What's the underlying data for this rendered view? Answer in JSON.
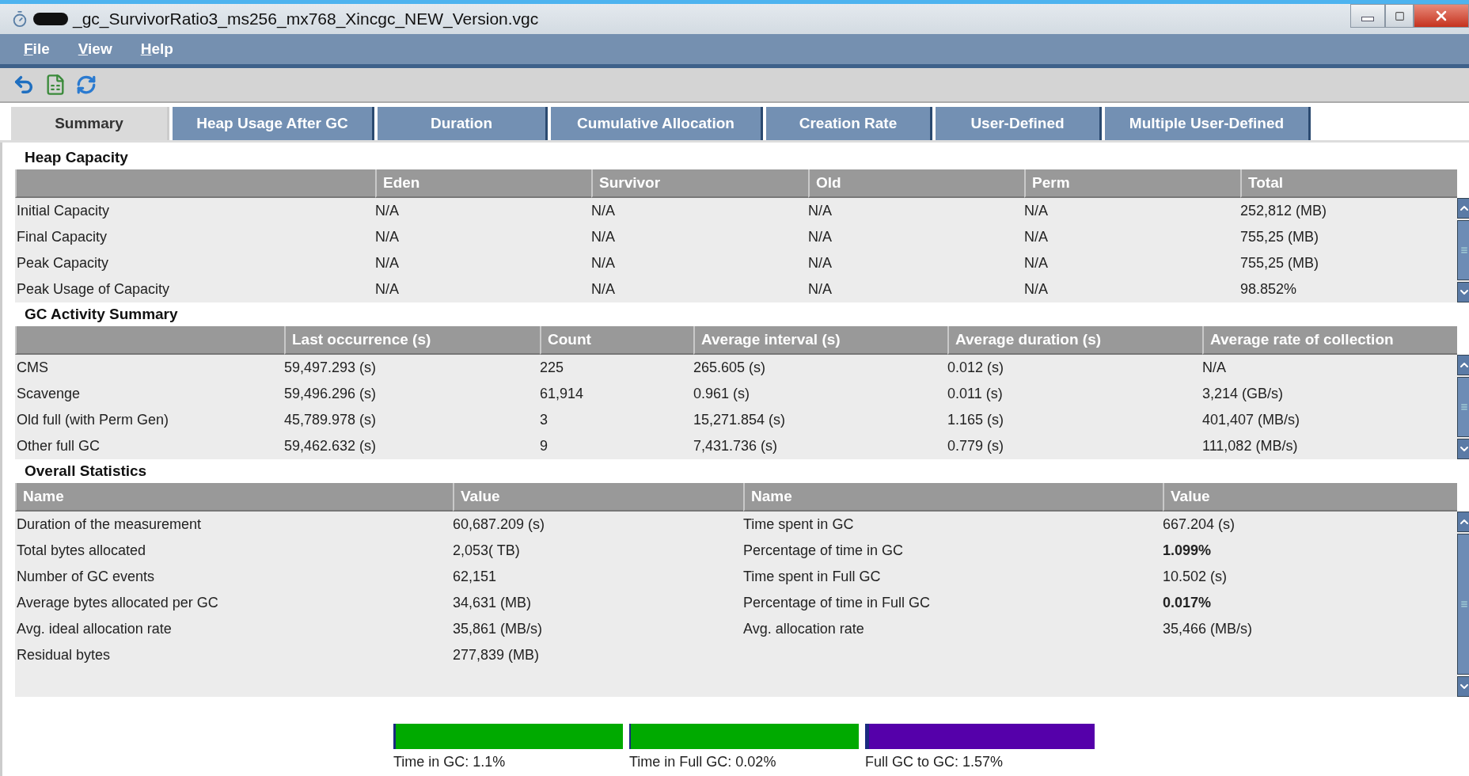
{
  "window": {
    "title": "_gc_SurvivorRatio3_ms256_mx768_Xincgc_NEW_Version.vgc"
  },
  "menu": [
    {
      "label": "File"
    },
    {
      "label": "View"
    },
    {
      "label": "Help"
    }
  ],
  "tabs": [
    {
      "label": "Summary",
      "selected": true
    },
    {
      "label": "Heap Usage After GC",
      "selected": false
    },
    {
      "label": "Duration",
      "selected": false
    },
    {
      "label": "Cumulative Allocation",
      "selected": false
    },
    {
      "label": "Creation Rate",
      "selected": false
    },
    {
      "label": "User-Defined",
      "selected": false
    },
    {
      "label": "Multiple User-Defined",
      "selected": false
    }
  ],
  "tables": [
    {
      "title": "Heap Capacity",
      "columns": [
        "",
        "Eden",
        "Survivor",
        "Old",
        "Perm",
        "Total"
      ],
      "rows": [
        [
          "Initial Capacity",
          "N/A",
          "N/A",
          "N/A",
          "N/A",
          "252,812 (MB)"
        ],
        [
          "Final Capacity",
          "N/A",
          "N/A",
          "N/A",
          "N/A",
          "755,25 (MB)"
        ],
        [
          "Peak Capacity",
          "N/A",
          "N/A",
          "N/A",
          "N/A",
          "755,25 (MB)"
        ],
        [
          "Peak Usage of Capacity",
          "N/A",
          "N/A",
          "N/A",
          "N/A",
          "98.852%"
        ]
      ]
    },
    {
      "title": "GC Activity Summary",
      "columns": [
        "",
        "Last occurrence (s)",
        "Count",
        "Average interval (s)",
        "Average duration (s)",
        "Average rate of collection"
      ],
      "rows": [
        [
          "CMS",
          "59,497.293 (s)",
          "225",
          "265.605 (s)",
          "0.012 (s)",
          "N/A"
        ],
        [
          "Scavenge",
          "59,496.296 (s)",
          "61,914",
          "0.961 (s)",
          "0.011 (s)",
          "3,214 (GB/s)"
        ],
        [
          "Old full (with Perm Gen)",
          "45,789.978 (s)",
          "3",
          "15,271.854 (s)",
          "1.165 (s)",
          "401,407 (MB/s)"
        ],
        [
          "Other full GC",
          "59,462.632 (s)",
          "9",
          "7,431.736 (s)",
          "0.779 (s)",
          "111,082 (MB/s)"
        ]
      ]
    },
    {
      "title": "Overall Statistics",
      "columns": [
        "Name",
        "Value",
        "Name",
        "Value"
      ],
      "rows": [
        [
          "Duration of the measurement",
          "60,687.209 (s)",
          "Time spent in GC",
          "667.204 (s)"
        ],
        [
          "Total bytes allocated",
          "2,053( TB)",
          "Percentage of time in GC",
          {
            "text": "1.099%",
            "bold": true
          }
        ],
        [
          "Number of GC events",
          "62,151",
          "Time spent in Full GC",
          "10.502 (s)"
        ],
        [
          "Average bytes allocated per GC",
          "34,631 (MB)",
          "Percentage of time in Full GC",
          {
            "text": "0.017%",
            "bold": true
          }
        ],
        [
          "Avg. ideal allocation rate",
          "35,861 (MB/s)",
          "Avg. allocation rate",
          "35,466 (MB/s)"
        ],
        [
          "Residual bytes",
          "277,839 (MB)"
        ]
      ]
    }
  ],
  "meters": [
    {
      "label": "Time in GC: 1.1%",
      "level": 0.011,
      "color": "#00aa00"
    },
    {
      "label": "Time in Full GC: 0.02%",
      "level": 0.0002,
      "color": "#00aa00"
    },
    {
      "label": "Full GC to GC: 1.57%",
      "level": 0.0157,
      "color": "#5500aa"
    }
  ]
}
